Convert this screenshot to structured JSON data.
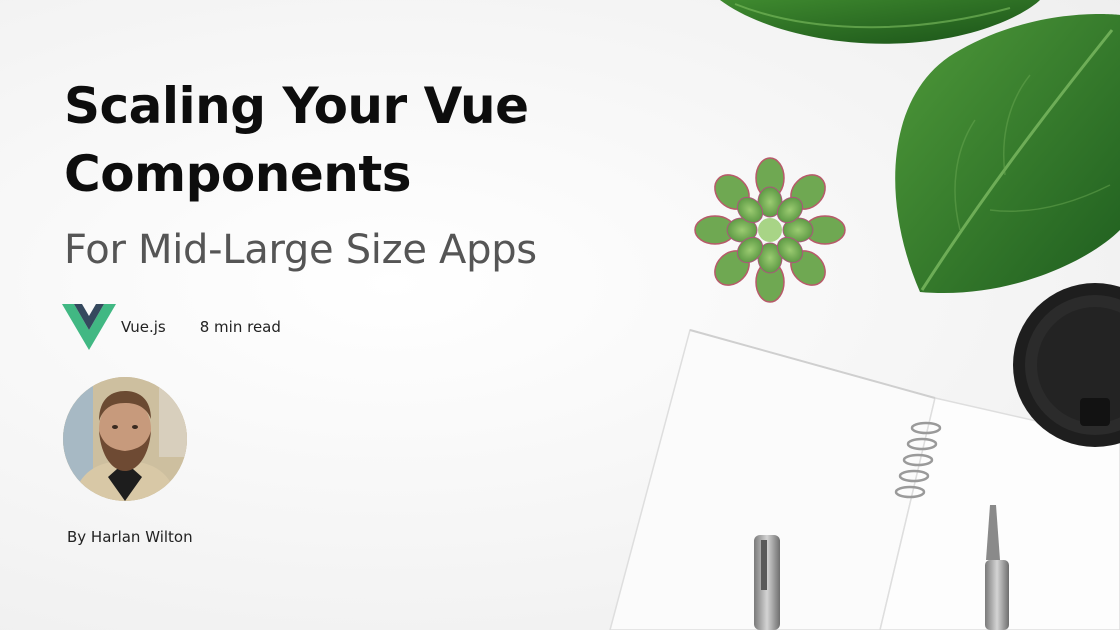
{
  "title_line1": "Scaling Your Vue",
  "title_line2": "Components",
  "subtitle": "For Mid-Large Size Apps",
  "meta": {
    "category": "Vue.js",
    "read_time": "8 min read"
  },
  "author": {
    "byline": "By Harlan Wilton"
  },
  "icons": {
    "category_logo": "vue-logo-icon"
  },
  "colors": {
    "vue_green": "#41b883",
    "vue_dark": "#35495e",
    "subtitle_gray": "#555555",
    "leaf_green": "#2f7d2a"
  }
}
